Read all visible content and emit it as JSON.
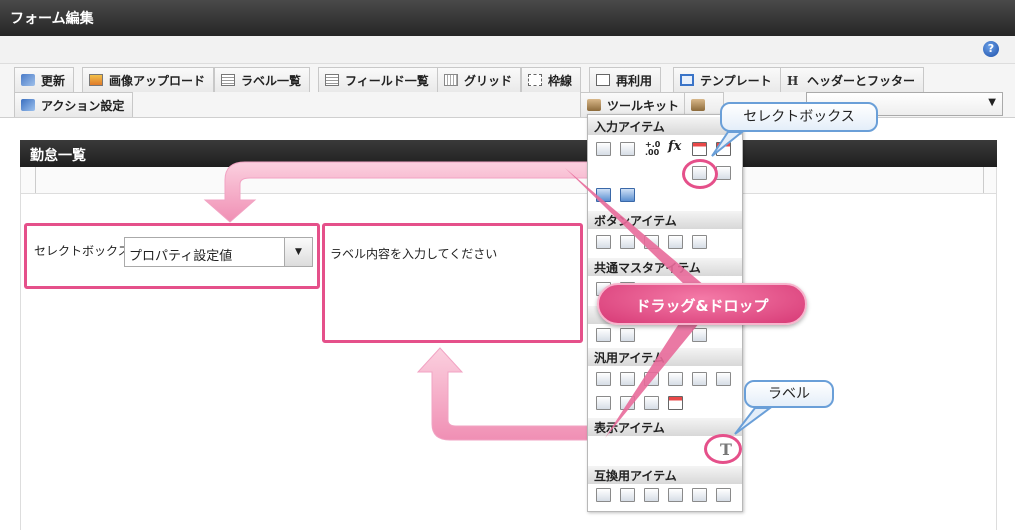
{
  "window": {
    "title": "フォーム編集"
  },
  "toolbar": {
    "row1": [
      {
        "label": "更新",
        "icon": "refresh-icon"
      },
      {
        "label": "画像アップロード",
        "icon": "image-upload-icon"
      },
      {
        "label": "ラベル一覧",
        "icon": "label-list-icon"
      },
      {
        "label": "フィールド一覧",
        "icon": "field-list-icon"
      },
      {
        "label": "グリッド",
        "icon": "grid-icon"
      },
      {
        "label": "枠線",
        "icon": "border-icon"
      },
      {
        "label": "再利用",
        "icon": "reuse-icon"
      },
      {
        "label": "テンプレート",
        "icon": "template-icon"
      },
      {
        "label": "ヘッダーとフッター",
        "icon": "header-footer-icon"
      }
    ],
    "row2": [
      {
        "label": "アクション設定",
        "icon": "action-icon"
      },
      {
        "label": "ツールキット",
        "icon": "toolkit-icon"
      }
    ],
    "help": "?"
  },
  "panel": {
    "title": "勤怠一覧"
  },
  "form": {
    "select_label": "セレクトボックス",
    "select_value": "プロパティ設定値",
    "label_placeholder": "ラベル内容を入力してください"
  },
  "toolkit": {
    "sections": [
      "入力アイテム",
      "ボタンアイテム",
      "共通マスタアイテム",
      "汎用アイテム",
      "表示アイテム",
      "互換用アイテム"
    ],
    "fx": "fx",
    "num_top": "+.0",
    "num_bottom": ".00",
    "text_icon": "T"
  },
  "annotations": {
    "selectbox_callout": "セレクトボックス",
    "drag_drop": "ドラッグ&ドロップ",
    "label_callout": "ラベル"
  },
  "colors": {
    "highlight": "#e5508a",
    "callout_border": "#6a9fd8",
    "arrow": "#f4a6c4"
  }
}
